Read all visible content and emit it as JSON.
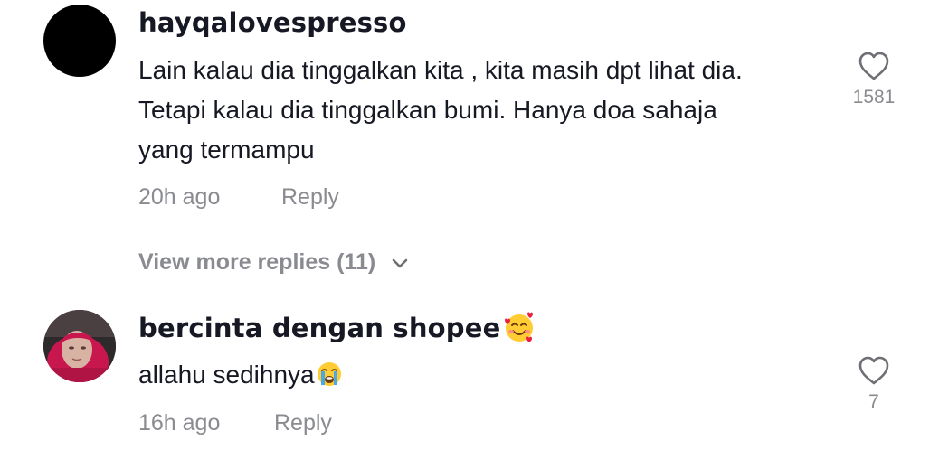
{
  "comments": [
    {
      "username": "hayqalovespresso",
      "text_lines": [
        "Lain kalau dia tinggalkan kita , kita masih dpt lihat dia.",
        "Tetapi kalau dia tinggalkan bumi. Hanya doa sahaja",
        "yang termampu"
      ],
      "time": "20h ago",
      "reply_label": "Reply",
      "likes": "1581",
      "view_more": "View more replies (11)"
    },
    {
      "username": "bercinta dengan shopee",
      "text": "allahu sedihnya",
      "time": "16h ago",
      "reply_label": "Reply",
      "likes": "7"
    }
  ],
  "icons": {
    "like": "heart-outline-icon",
    "expand": "chevron-down-icon",
    "username_emoji": "smiling-face-with-hearts-icon",
    "comment_emoji": "loudly-crying-face-icon"
  },
  "colors": {
    "primary_text": "#161823",
    "secondary_text": "#8a8b91",
    "icon": "#6e6f75"
  }
}
